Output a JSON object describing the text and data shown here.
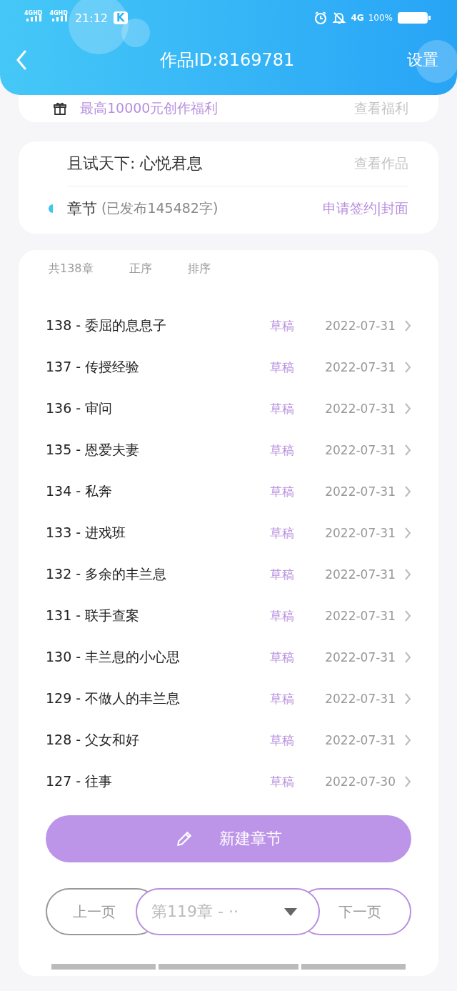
{
  "status_bar": {
    "signal_1": "4GHD",
    "signal_2": "4GHD",
    "time": "21:12",
    "app_badge": "K",
    "network": "4G",
    "battery": "100%"
  },
  "header": {
    "title": "作品ID:8169781",
    "action": "设置"
  },
  "benefit": {
    "text": "最高10000元创作福利",
    "link": "查看福利"
  },
  "work": {
    "title": "且试天下: 心悦君息",
    "link": "查看作品",
    "chapters_label": "章节",
    "chapters_count": "(已发布145482字)",
    "sign_link": "申请签约|封面"
  },
  "toolbar": {
    "total": "共138章",
    "order": "正序",
    "sort": "排序"
  },
  "chapters": [
    {
      "title": "138 - 委屈的息息子",
      "status": "草稿",
      "date": "2022-07-31"
    },
    {
      "title": "137 - 传授经验",
      "status": "草稿",
      "date": "2022-07-31"
    },
    {
      "title": "136 - 审问",
      "status": "草稿",
      "date": "2022-07-31"
    },
    {
      "title": "135 - 恩爱夫妻",
      "status": "草稿",
      "date": "2022-07-31"
    },
    {
      "title": "134 - 私奔",
      "status": "草稿",
      "date": "2022-07-31"
    },
    {
      "title": "133 - 进戏班",
      "status": "草稿",
      "date": "2022-07-31"
    },
    {
      "title": "132 - 多余的丰兰息",
      "status": "草稿",
      "date": "2022-07-31"
    },
    {
      "title": "131 - 联手查案",
      "status": "草稿",
      "date": "2022-07-31"
    },
    {
      "title": "130 - 丰兰息的小心思",
      "status": "草稿",
      "date": "2022-07-31"
    },
    {
      "title": "129 - 不做人的丰兰息",
      "status": "草稿",
      "date": "2022-07-31"
    },
    {
      "title": "128 - 父女和好",
      "status": "草稿",
      "date": "2022-07-31"
    },
    {
      "title": "127 - 往事",
      "status": "草稿",
      "date": "2022-07-30"
    }
  ],
  "new_chapter_button": "新建章节",
  "pager": {
    "prev": {
      "label": "上一页",
      "disabled": true
    },
    "select": "第119章 - ··",
    "next": {
      "label": "下一页",
      "disabled": false
    }
  }
}
